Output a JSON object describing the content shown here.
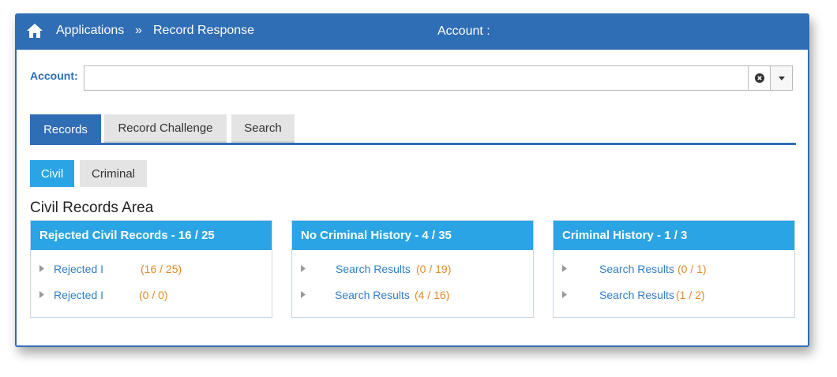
{
  "header": {
    "breadcrumb_apps": "Applications",
    "breadcrumb_separator": "»",
    "breadcrumb_current": "Record Response",
    "account_title": "Account :"
  },
  "account": {
    "label": "Account:",
    "value": ""
  },
  "tabs": [
    {
      "label": "Records",
      "active": true
    },
    {
      "label": "Record Challenge",
      "active": false
    },
    {
      "label": "Search",
      "active": false
    }
  ],
  "subtabs": [
    {
      "label": "Civil",
      "active": true
    },
    {
      "label": "Criminal",
      "active": false
    }
  ],
  "area_title": "Civil Records Area",
  "panels": [
    {
      "title": "Rejected Civil Records - 16 / 25",
      "rows": [
        {
          "label": "Rejected I",
          "count": "(16 / 25)"
        },
        {
          "label": "Rejected I",
          "count": "(0 / 0)"
        }
      ]
    },
    {
      "title": "No Criminal History - 4 / 35",
      "rows": [
        {
          "label": "Search Results",
          "count": "(0 / 19)"
        },
        {
          "label": "Search Results",
          "count": "(4 / 16)"
        }
      ]
    },
    {
      "title": "Criminal History - 1 / 3",
      "rows": [
        {
          "label": "Search Results",
          "count": "(0 / 1)"
        },
        {
          "label": "Search Results",
          "count": "(1 / 2)"
        }
      ]
    }
  ],
  "colors": {
    "primary": "#2f6db5",
    "accent": "#2aa4e4",
    "link": "#2f7ec8",
    "count": "#e38a2c"
  }
}
